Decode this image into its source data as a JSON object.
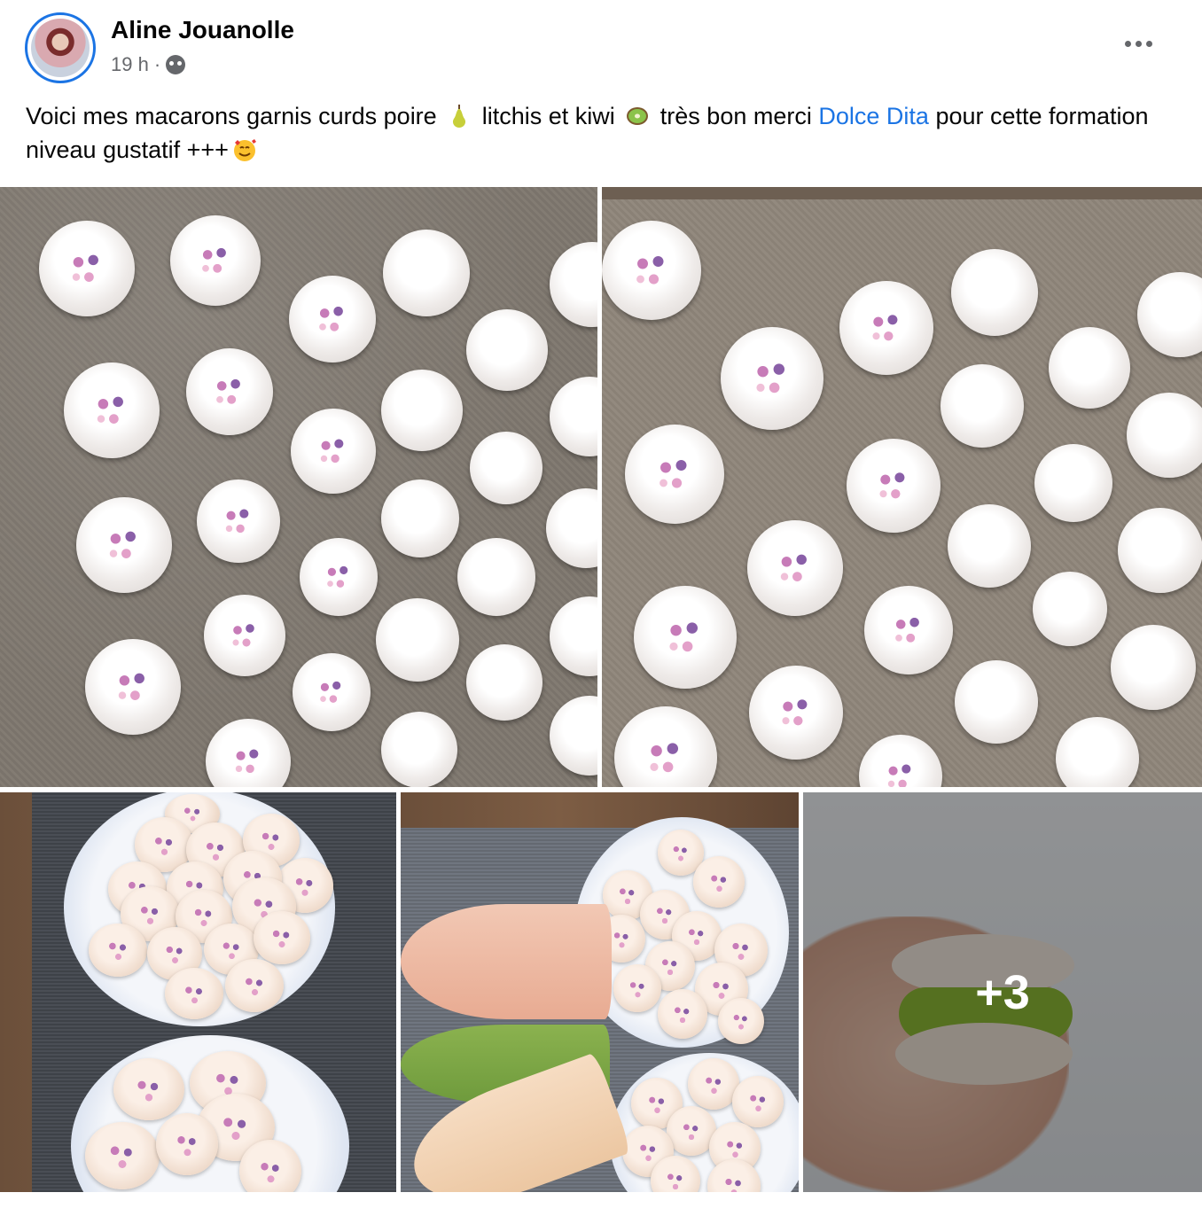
{
  "post": {
    "author": "Aline Jouanolle",
    "time": "19 h",
    "separator": "·",
    "text_part1": "Voici mes macarons garnis curds poire",
    "text_part2": "litchis et kiwi",
    "text_part3": "très bon merci",
    "mention": "Dolce Dita",
    "text_part4": "pour cette formation niveau gustatif +++",
    "emojis": [
      "pear-emoji",
      "kiwi-emoji",
      "smiling-face-with-hearts-emoji"
    ],
    "audience_icon": "friends-icon",
    "more_icon": "more-options-icon"
  },
  "photos": {
    "extra_count": "+3",
    "items": [
      "macaron-shells-tray-1",
      "macaron-shells-tray-2",
      "macarons-on-plates",
      "macarons-with-piping-bags",
      "macaron-kiwi-filling-in-hand"
    ]
  },
  "colors": {
    "mention": "#1b74e4",
    "avatar_ring": "#1b74e4",
    "secondary_text": "#65676b"
  }
}
